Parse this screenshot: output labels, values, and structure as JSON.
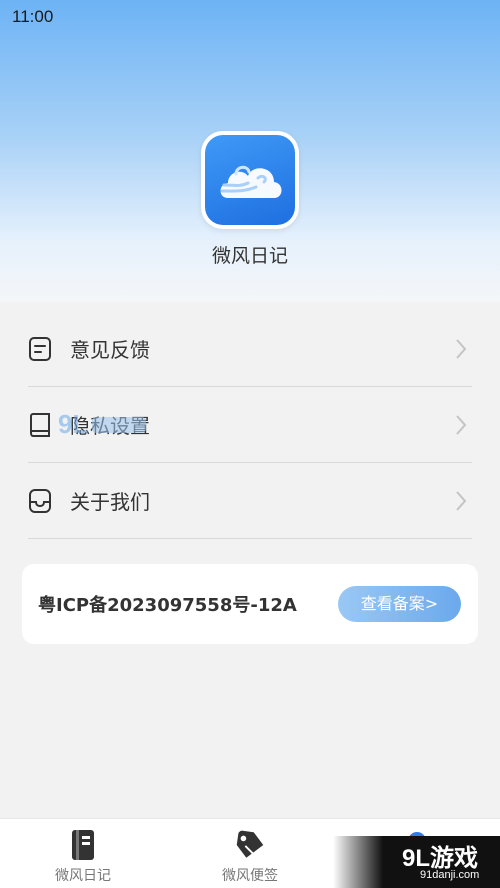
{
  "status_bar": {
    "time": "11:00"
  },
  "app": {
    "name": "微风日记"
  },
  "menu": {
    "items": [
      {
        "label": "意见反馈",
        "icon": "feedback-icon"
      },
      {
        "label": "隐私设置",
        "icon": "book-icon"
      },
      {
        "label": "关于我们",
        "icon": "inbox-icon"
      }
    ]
  },
  "icp": {
    "number": "粤ICP备2023097558号-12A",
    "button_label": "查看备案>"
  },
  "tabbar": {
    "tabs": [
      {
        "label": "微风日记",
        "icon": "notebook-icon"
      },
      {
        "label": "微风便签",
        "icon": "tag-icon"
      },
      {
        "label": "",
        "icon": "profile-icon"
      }
    ]
  },
  "watermark": {
    "main": "9L游戏",
    "sub": "91danji.com"
  },
  "colors": {
    "accent": "#2f7be5",
    "button_gradient_start": "#9ac8f5",
    "button_gradient_end": "#6ba9ec",
    "hero_top": "#6db3f5"
  }
}
